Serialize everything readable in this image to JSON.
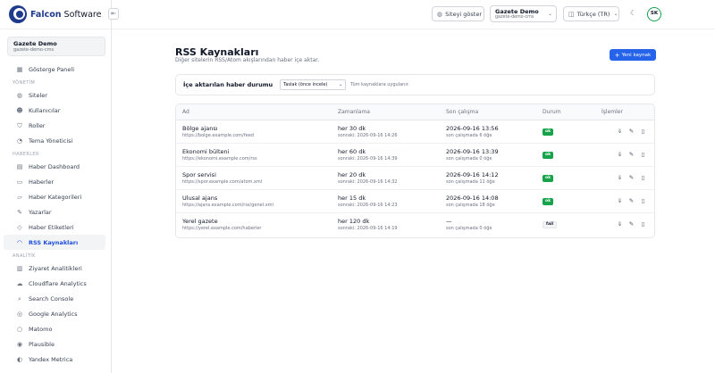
{
  "brand": {
    "name_bold": "Falcon",
    "name_rest": " Software",
    "color": "#1e3a8a"
  },
  "sidebar": {
    "tenant": {
      "name": "Gazete Demo",
      "slug": "gazete-demo-cms"
    },
    "items_top": [
      {
        "label": "Gösterge Paneli",
        "icon": "grid-icon"
      }
    ],
    "sections": [
      {
        "title": "YÖNETİM",
        "items": [
          {
            "label": "Siteler",
            "icon": "globe-icon"
          },
          {
            "label": "Kullanıcılar",
            "icon": "users-icon"
          },
          {
            "label": "Roller",
            "icon": "shield-icon"
          },
          {
            "label": "Tema Yöneticisi",
            "icon": "palette-icon"
          }
        ]
      },
      {
        "title": "HABERLER",
        "items": [
          {
            "label": "Haber Dashboard",
            "icon": "dashboard-icon"
          },
          {
            "label": "Haberler",
            "icon": "newspaper-icon"
          },
          {
            "label": "Haber Kategorileri",
            "icon": "folder-icon"
          },
          {
            "label": "Yazarlar",
            "icon": "pen-icon"
          },
          {
            "label": "Haber Etiketleri",
            "icon": "tag-icon"
          },
          {
            "label": "RSS Kaynakları",
            "icon": "rss-icon",
            "active": true
          }
        ]
      },
      {
        "title": "ANALİTİK",
        "items": [
          {
            "label": "Ziyaret Analitikleri",
            "icon": "chart-icon"
          },
          {
            "label": "Cloudflare Analytics",
            "icon": "cloud-icon"
          },
          {
            "label": "Search Console",
            "icon": "search-icon"
          },
          {
            "label": "Google Analytics",
            "icon": "analytics-icon"
          },
          {
            "label": "Matomo",
            "icon": "matomo-icon"
          },
          {
            "label": "Plausible",
            "icon": "plausible-icon"
          },
          {
            "label": "Yandex Metrica",
            "icon": "yandex-icon"
          }
        ]
      }
    ]
  },
  "topbar": {
    "show_site": "Siteyi göster",
    "tenant_name": "Gazete Demo",
    "tenant_slug": "gazete-demo-cms",
    "language": "Türkçe (TR)",
    "avatar_initials": "SK"
  },
  "page": {
    "title": "RSS Kaynakları",
    "subtitle": "Diğer sitelerin RSS/Atom akışlarından haber içe aktar.",
    "add_button": "Yeni kaynak"
  },
  "filter": {
    "label": "İçe aktarılan haber durumu",
    "selected": "Taslak (önce incele)",
    "note": "Tüm kaynaklara uygulanır."
  },
  "table": {
    "columns": {
      "name": "Ad",
      "schedule": "Zamanlama",
      "last_run": "Son çalışma",
      "status": "Durum",
      "actions": "İşlemler"
    },
    "rows": [
      {
        "name": "Bölge ajansı",
        "url": "https://bolge.example.com/feed",
        "schedule": "her 30 dk",
        "next": "sonraki: 2026-09-16 14:26",
        "last": "2026-09-16 13:56",
        "last_sub": "son çalışmada 6 öğe",
        "status": "ok",
        "status_type": "ok"
      },
      {
        "name": "Ekonomi bülteni",
        "url": "https://ekonomi.example.com/rss",
        "schedule": "her 60 dk",
        "next": "sonraki: 2026-09-16 14:39",
        "last": "2026-09-16 13:39",
        "last_sub": "son çalışmada 0 öğe",
        "status": "ok",
        "status_type": "ok"
      },
      {
        "name": "Spor servisi",
        "url": "https://spor.example.com/atom.xml",
        "schedule": "her 20 dk",
        "next": "sonraki: 2026-09-16 14:32",
        "last": "2026-09-16 14:12",
        "last_sub": "son çalışmada 11 öğe",
        "status": "ok",
        "status_type": "ok"
      },
      {
        "name": "Ulusal ajans",
        "url": "https://ajans.example.com/rss/genel.xml",
        "schedule": "her 15 dk",
        "next": "sonraki: 2026-09-16 14:23",
        "last": "2026-09-16 14:08",
        "last_sub": "son çalışmada 18 öğe",
        "status": "ok",
        "status_type": "ok"
      },
      {
        "name": "Yerel gazete",
        "url": "https://yerel.example.com/haberler",
        "schedule": "her 120 dk",
        "next": "sonraki: 2026-09-16 14:19",
        "last": "—",
        "last_sub": "son çalışmada 0 öğe",
        "status": "fail",
        "status_type": "fail"
      }
    ]
  },
  "colors": {
    "accent": "#2563eb",
    "ok": "#16a34a",
    "active_nav": "#1d4ed8"
  }
}
